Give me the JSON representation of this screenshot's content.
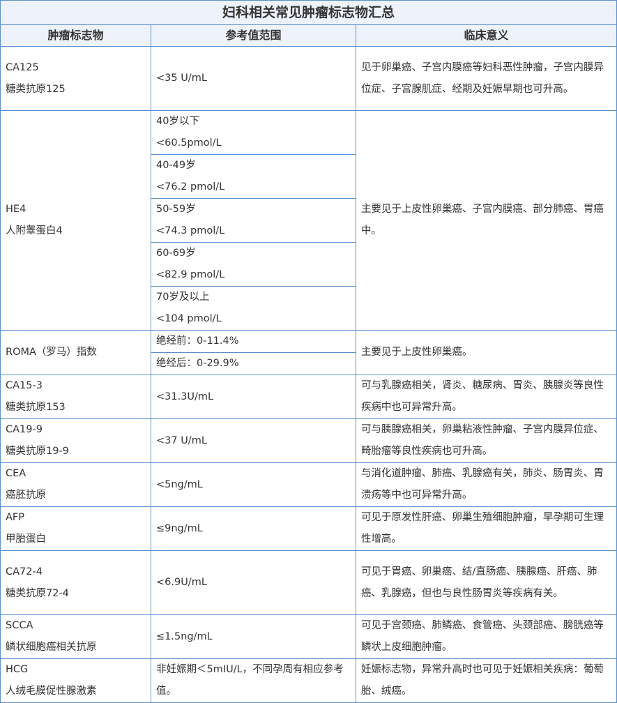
{
  "title": "妇科相关常见肿瘤标志物汇总",
  "headers": [
    "肿瘤标志物",
    "参考值范围",
    "临床意义"
  ],
  "rows": {
    "ca125": {
      "name": "CA125",
      "alias": "糖类抗原125",
      "ref": "<35 U/mL",
      "meaning": "见于卵巢癌、子宫内膜癌等妇科恶性肿瘤，子宫内膜异位症、子宫腺肌症、经期及妊娠早期也可升高。"
    },
    "he4": {
      "name": "HE4",
      "alias": "人附睾蛋白4",
      "refs": [
        {
          "age": "40岁以下",
          "value": "<60.5pmol/L"
        },
        {
          "age": "40-49岁",
          "value": "<76.2 pmol/L"
        },
        {
          "age": "50-59岁",
          "value": "<74.3 pmol/L"
        },
        {
          "age": "60-69岁",
          "value": "<82.9 pmol/L"
        },
        {
          "age": "70岁及以上",
          "value": "<104 pmol/L"
        }
      ],
      "meaning": "主要见于上皮性卵巢癌、子宫内膜癌、部分肺癌、胃癌中。"
    },
    "roma": {
      "name": "ROMA（罗马）指数",
      "refs": [
        "绝经前：0-11.4%",
        "绝经后：0-29.9%"
      ],
      "meaning": "主要见于上皮性卵巢癌。"
    },
    "ca153": {
      "name": "CA15-3",
      "alias": "糖类抗原153",
      "ref": "<31.3U/mL",
      "meaning": "可与乳腺癌相关，肾炎、糖尿病、胃炎、胰腺炎等良性疾病中也可异常升高。"
    },
    "ca199": {
      "name": "CA19-9",
      "alias": "糖类抗原19-9",
      "ref": "<37 U/mL",
      "meaning": "可与胰腺癌相关，卵巢粘液性肿瘤、子宫内膜异位症、畸胎瘤等良性疾病也可升高。"
    },
    "cea": {
      "name": "CEA",
      "alias": "癌胚抗原",
      "ref": "<5ng/mL",
      "meaning": "与消化道肿瘤、肺癌、乳腺癌有关，肺炎、肠胃炎、胃溃疡等中也可异常升高。"
    },
    "afp": {
      "name": "AFP",
      "alias": "甲胎蛋白",
      "ref": "≤9ng/mL",
      "meaning": "可见于原发性肝癌、卵巢生殖细胞肿瘤，早孕期可生理性增高。"
    },
    "ca724": {
      "name": "CA72-4",
      "alias": "糖类抗原72-4",
      "ref": "<6.9U/mL",
      "meaning": "可见于胃癌、卵巢癌、结/直肠癌、胰腺癌、肝癌、肺癌、乳腺癌，但也与良性肠胃炎等疾病有关。"
    },
    "scca": {
      "name": "SCCA",
      "alias": "鳞状细胞癌相关抗原",
      "ref": "≤1.5ng/mL",
      "meaning": "可见于宫颈癌、肺鳞癌、食管癌、头颈部癌、膀胱癌等鳞状上皮细胞肿瘤。"
    },
    "hcg": {
      "name": "HCG",
      "alias": "人绒毛膜促性腺激素",
      "ref": "非妊娠期＜5mIU/L，不同孕周有相应参考值。",
      "meaning": "妊娠标志物，异常升高时也可见于妊娠相关疾病：葡萄胎、绒癌。"
    }
  }
}
